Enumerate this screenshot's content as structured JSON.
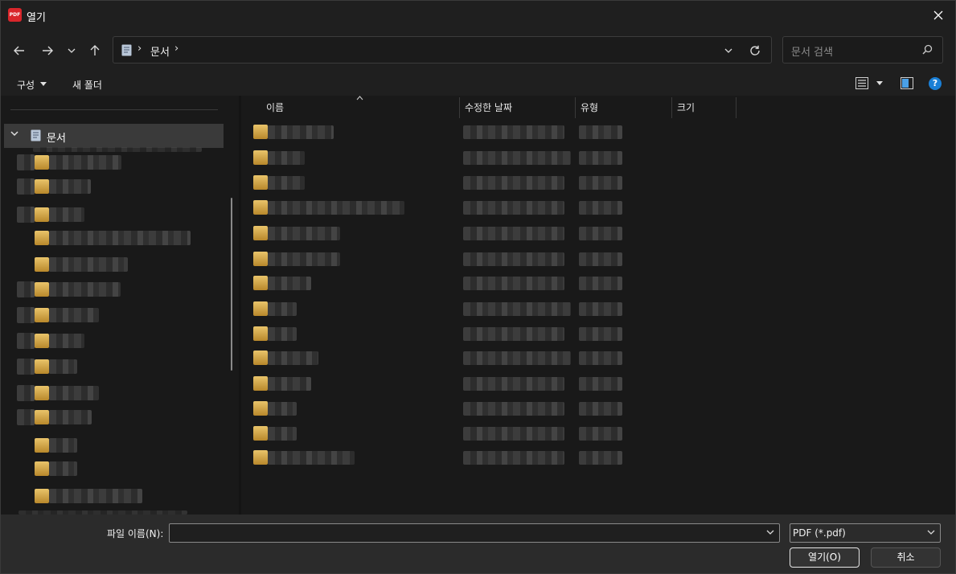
{
  "titlebar": {
    "app_badge": "PDF",
    "title": "열기"
  },
  "address": {
    "crumbs": [
      "문서"
    ]
  },
  "search": {
    "placeholder": "문서 검색"
  },
  "toolbar": {
    "organize_label": "구성",
    "new_folder_label": "새 폴더"
  },
  "navpane": {
    "selected_label": "문서",
    "items_blurred": true,
    "item_count": 14
  },
  "filelist": {
    "columns": [
      "이름",
      "수정한 날짜",
      "유형",
      "크기"
    ],
    "sort_column": "이름",
    "rows_blurred": true,
    "row_count": 14
  },
  "footer": {
    "filename_label": "파일 이름(N):",
    "filename_value": "",
    "filter_value": "PDF (*.pdf)",
    "open_label": "열기(O)",
    "cancel_label": "취소"
  },
  "colors": {
    "accent": "#1a7fd6",
    "app_icon": "#d9262b",
    "folder": "#e9c46a"
  }
}
